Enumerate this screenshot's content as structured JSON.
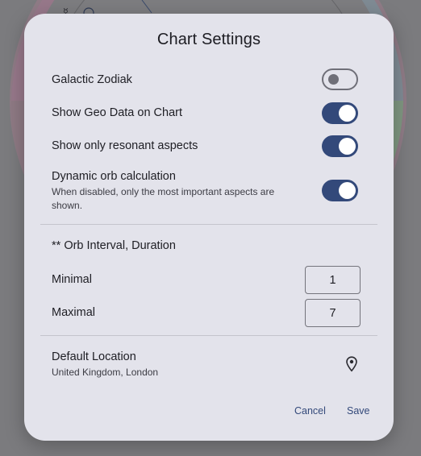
{
  "dialog": {
    "title": "Chart Settings",
    "toggles": [
      {
        "label": "Galactic Zodiak",
        "on": false
      },
      {
        "label": "Show Geo Data on Chart",
        "on": true
      },
      {
        "label": "Show only resonant aspects",
        "on": true
      },
      {
        "label": "Dynamic orb calculation",
        "sub": "When disabled, only the most important aspects are shown.",
        "on": true
      }
    ],
    "orb": {
      "heading": "** Orb Interval, Duration",
      "minimal_label": "Minimal",
      "minimal_value": "1",
      "maximal_label": "Maximal",
      "maximal_value": "7"
    },
    "location": {
      "label": "Default Location",
      "value": "United Kingdom, London",
      "icon": "location-pin-icon"
    },
    "buttons": {
      "cancel": "Cancel",
      "save": "Save"
    }
  },
  "colors": {
    "accent": "#33497a",
    "dialog_bg": "#e3e3eb",
    "scrim": "#7b7b7e"
  }
}
